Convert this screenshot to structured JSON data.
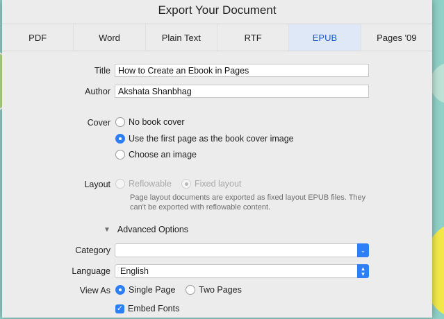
{
  "dialog": {
    "title": "Export Your Document"
  },
  "tabs": [
    {
      "label": "PDF",
      "active": false
    },
    {
      "label": "Word",
      "active": false
    },
    {
      "label": "Plain Text",
      "active": false
    },
    {
      "label": "RTF",
      "active": false
    },
    {
      "label": "EPUB",
      "active": true
    },
    {
      "label": "Pages '09",
      "active": false
    }
  ],
  "form": {
    "title_label": "Title",
    "title_value": "How to Create an Ebook in Pages",
    "author_label": "Author",
    "author_value": "Akshata Shanbhag",
    "cover_label": "Cover",
    "cover_options": [
      {
        "label": "No book cover",
        "selected": false
      },
      {
        "label": "Use the first page as the book cover image",
        "selected": true
      },
      {
        "label": "Choose an image",
        "selected": false
      }
    ],
    "layout_label": "Layout",
    "layout_options": [
      {
        "label": "Reflowable",
        "selected": false
      },
      {
        "label": "Fixed layout",
        "selected": true
      }
    ],
    "layout_note": "Page layout documents are exported as fixed layout EPUB files. They can't be exported with reflowable content.",
    "advanced_label": "Advanced Options",
    "category_label": "Category",
    "category_value": "",
    "language_label": "Language",
    "language_value": "English",
    "view_as_label": "View As",
    "view_options": [
      {
        "label": "Single Page",
        "selected": true
      },
      {
        "label": "Two Pages",
        "selected": false
      }
    ],
    "embed_fonts_label": "Embed Fonts",
    "embed_fonts_checked": true
  },
  "colors": {
    "accent": "#2d7ef7",
    "background": "#8fd0c7"
  }
}
